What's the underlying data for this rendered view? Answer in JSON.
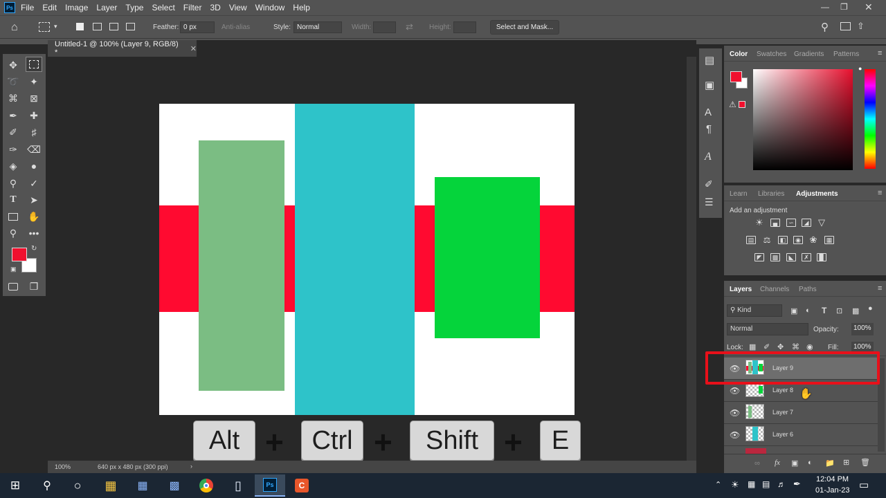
{
  "menubar": {
    "logo": "Ps",
    "items": [
      "File",
      "Edit",
      "Image",
      "Layer",
      "Type",
      "Select",
      "Filter",
      "3D",
      "View",
      "Window",
      "Help"
    ]
  },
  "options": {
    "feather_label": "Feather:",
    "feather_value": "0 px",
    "antialias_label": "Anti-alias",
    "style_label": "Style:",
    "style_value": "Normal",
    "width_label": "Width:",
    "height_label": "Height:",
    "select_mask": "Select and Mask..."
  },
  "document": {
    "tab_title": "Untitled-1 @ 100% (Layer 9, RGB/8) *",
    "zoom": "100%",
    "info": "640 px x 480 px (300 ppi)"
  },
  "canvas_colors": {
    "red": "#ff0a30",
    "sage": "#7bbd83",
    "cyan": "#2ec3c9",
    "green": "#05d43b",
    "white": "#ffffff"
  },
  "shortcut_keys": [
    {
      "label": "Alt"
    },
    {
      "label": "Ctrl"
    },
    {
      "label": "Shift"
    },
    {
      "label": "E"
    }
  ],
  "shortcut_plus": "+",
  "color_panel": {
    "tabs": [
      "Color",
      "Swatches",
      "Gradients",
      "Patterns"
    ],
    "active": "Color",
    "foreground": "#f0102e",
    "background": "#ffffff"
  },
  "adjustments": {
    "tabs": [
      "Learn",
      "Libraries",
      "Adjustments"
    ],
    "active": "Adjustments",
    "hint": "Add an adjustment"
  },
  "layers_panel": {
    "tabs": [
      "Layers",
      "Channels",
      "Paths"
    ],
    "active": "Layers",
    "kind_label": "Kind",
    "blend_mode": "Normal",
    "opacity_label": "Opacity:",
    "opacity_value": "100%",
    "lock_label": "Lock:",
    "fill_label": "Fill:",
    "fill_value": "100%",
    "layers": [
      {
        "name": "Layer 9",
        "selected": true
      },
      {
        "name": "Layer 8",
        "selected": false
      },
      {
        "name": "Layer 7",
        "selected": false
      },
      {
        "name": "Layer 6",
        "selected": false
      }
    ]
  },
  "taskbar": {
    "time": "12:04 PM",
    "date": "01-Jan-23"
  },
  "highlight_color": "#e8101a"
}
